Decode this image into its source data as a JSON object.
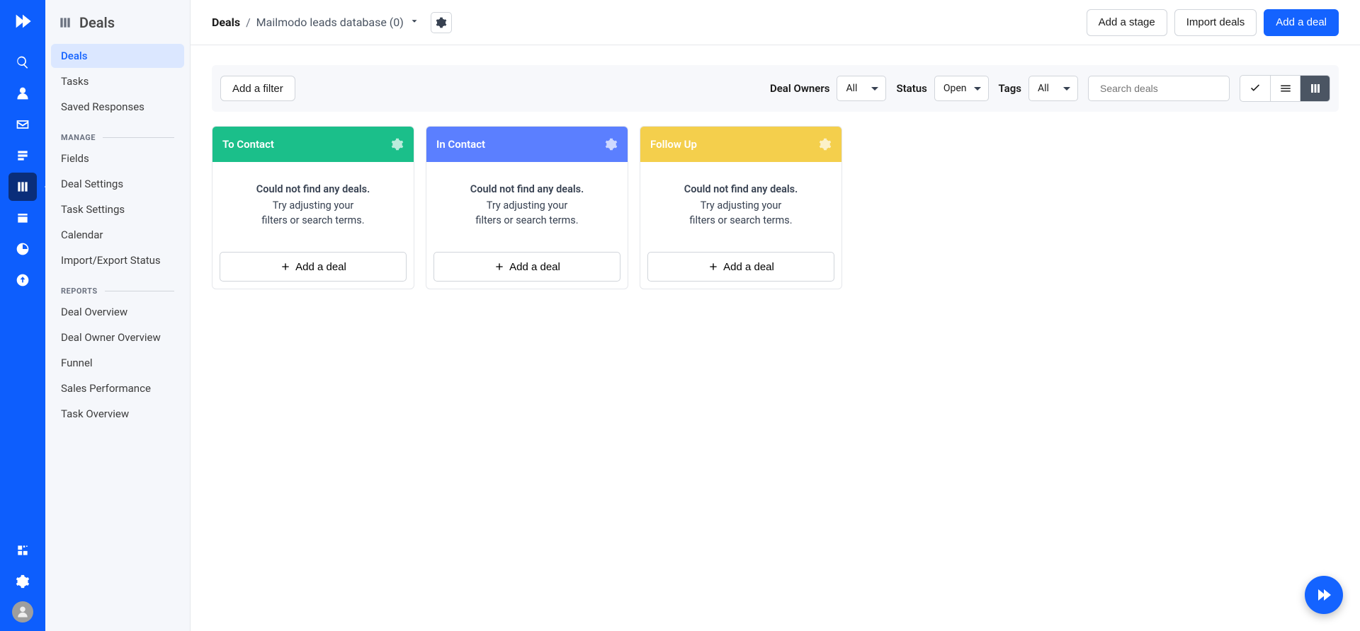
{
  "sidebar": {
    "title": "Deals",
    "items": [
      {
        "label": "Deals",
        "active": true
      },
      {
        "label": "Tasks",
        "active": false
      },
      {
        "label": "Saved Responses",
        "active": false
      }
    ],
    "sections": [
      {
        "label": "MANAGE",
        "items": [
          {
            "label": "Fields"
          },
          {
            "label": "Deal Settings"
          },
          {
            "label": "Task Settings"
          },
          {
            "label": "Calendar"
          },
          {
            "label": "Import/Export Status"
          }
        ]
      },
      {
        "label": "REPORTS",
        "items": [
          {
            "label": "Deal Overview"
          },
          {
            "label": "Deal Owner Overview"
          },
          {
            "label": "Funnel"
          },
          {
            "label": "Sales Performance"
          },
          {
            "label": "Task Overview"
          }
        ]
      }
    ]
  },
  "breadcrumb": {
    "root": "Deals",
    "leaf": "Mailmodo leads database (0)"
  },
  "topbar": {
    "add_stage": "Add a stage",
    "import_deals": "Import deals",
    "add_deal": "Add a deal"
  },
  "filters": {
    "add_filter": "Add a filter",
    "deal_owners_label": "Deal Owners",
    "deal_owners_value": "All",
    "status_label": "Status",
    "status_value": "Open",
    "tags_label": "Tags",
    "tags_value": "All",
    "search_placeholder": "Search deals"
  },
  "board": {
    "empty_msg1": "Could not find any deals.",
    "empty_msg2": "Try adjusting your",
    "empty_msg3": "filters or search terms.",
    "add_deal_label": "Add a deal",
    "columns": [
      {
        "title": "To Contact",
        "color": "#1bbf8a"
      },
      {
        "title": "In Contact",
        "color": "#5b7fff"
      },
      {
        "title": "Follow Up",
        "color": "#f4cf4c"
      }
    ]
  }
}
